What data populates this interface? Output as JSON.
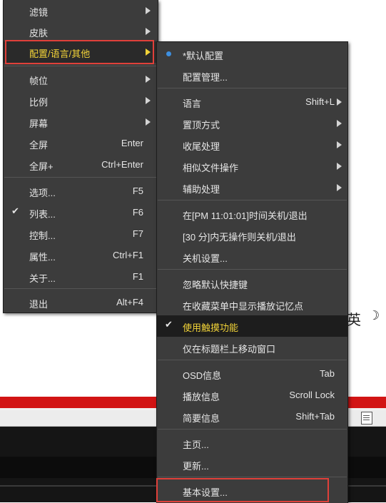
{
  "main_menu": {
    "items": [
      {
        "label": "滤镜",
        "shortcut": ""
      },
      {
        "label": "皮肤",
        "shortcut": ""
      },
      {
        "label": "配置/语言/其他",
        "shortcut": ""
      },
      {
        "label": "帧位",
        "shortcut": ""
      },
      {
        "label": "比例",
        "shortcut": ""
      },
      {
        "label": "屏幕",
        "shortcut": ""
      },
      {
        "label": "全屏",
        "shortcut": "Enter"
      },
      {
        "label": "全屏+",
        "shortcut": "Ctrl+Enter"
      },
      {
        "label": "选项...",
        "shortcut": "F5"
      },
      {
        "label": "列表...",
        "shortcut": "F6"
      },
      {
        "label": "控制...",
        "shortcut": "F7"
      },
      {
        "label": "属性...",
        "shortcut": "Ctrl+F1"
      },
      {
        "label": "关于...",
        "shortcut": "F1"
      },
      {
        "label": "退出",
        "shortcut": "Alt+F4"
      }
    ]
  },
  "sub_menu": {
    "items": [
      {
        "label": "*默认配置",
        "shortcut": ""
      },
      {
        "label": "配置管理...",
        "shortcut": ""
      },
      {
        "label": "语言",
        "shortcut": "Shift+L"
      },
      {
        "label": "置顶方式",
        "shortcut": ""
      },
      {
        "label": "收尾处理",
        "shortcut": ""
      },
      {
        "label": "相似文件操作",
        "shortcut": ""
      },
      {
        "label": "辅助处理",
        "shortcut": ""
      },
      {
        "label": "在[PM 11:01:01]时间关机/退出",
        "shortcut": ""
      },
      {
        "label": "[30 分]内无操作则关机/退出",
        "shortcut": ""
      },
      {
        "label": "关机设置...",
        "shortcut": ""
      },
      {
        "label": "忽略默认快捷键",
        "shortcut": ""
      },
      {
        "label": "在收藏菜单中显示播放记忆点",
        "shortcut": ""
      },
      {
        "label": "使用触摸功能",
        "shortcut": ""
      },
      {
        "label": "仅在标题栏上移动窗口",
        "shortcut": ""
      },
      {
        "label": "OSD信息",
        "shortcut": "Tab"
      },
      {
        "label": "播放信息",
        "shortcut": "Scroll Lock"
      },
      {
        "label": "简要信息",
        "shortcut": "Shift+Tab"
      },
      {
        "label": "主页...",
        "shortcut": ""
      },
      {
        "label": "更新...",
        "shortcut": ""
      },
      {
        "label": "基本设置...",
        "shortcut": ""
      }
    ]
  },
  "background": {
    "ime_text": "英",
    "ime_moon": "☽"
  },
  "colors": {
    "menu_bg": "#3c3c3c",
    "highlight_text": "#f2d338",
    "annotation_red": "#e0403a",
    "radio_blue": "#3d8fe0"
  }
}
